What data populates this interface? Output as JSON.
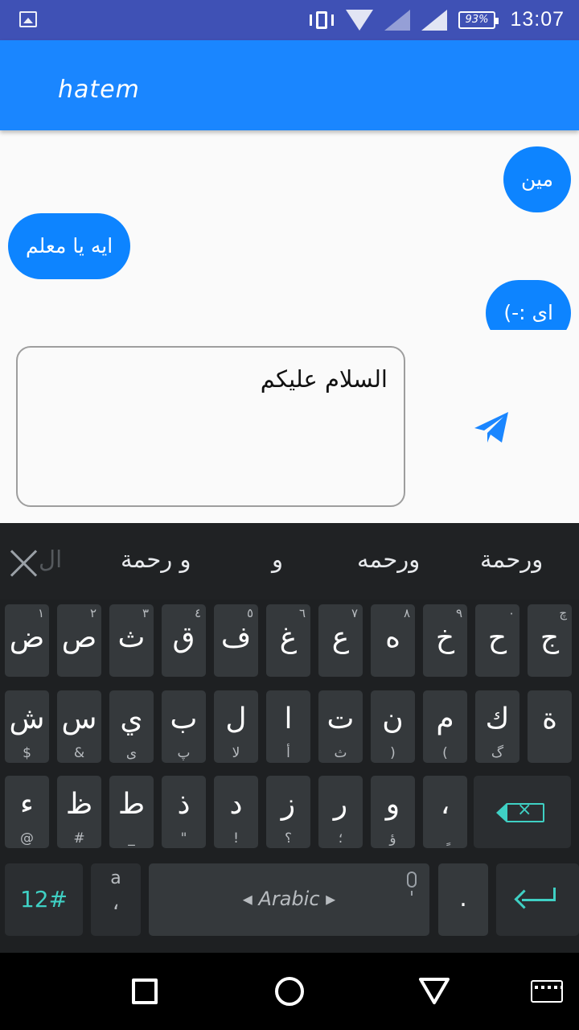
{
  "status_bar": {
    "battery": "93%",
    "time": "13:07"
  },
  "app_bar": {
    "title": "hatem"
  },
  "messages": [
    {
      "text": "مين",
      "side": "right"
    },
    {
      "text": "ايه يا معلم",
      "side": "left"
    },
    {
      "text": "اى :-)",
      "side": "right"
    }
  ],
  "composer": {
    "text": "السلام عليكم"
  },
  "keyboard": {
    "suggestions": [
      "ورحمة",
      "ورحمه",
      "و",
      "و رحمة",
      "ال"
    ],
    "row1": [
      {
        "main": "ض",
        "hint": "١"
      },
      {
        "main": "ص",
        "hint": "٢"
      },
      {
        "main": "ث",
        "hint": "٣"
      },
      {
        "main": "ق",
        "hint": "٤"
      },
      {
        "main": "ف",
        "hint": "٥"
      },
      {
        "main": "غ",
        "hint": "٦"
      },
      {
        "main": "ع",
        "hint": "٧"
      },
      {
        "main": "ه",
        "hint": "٨"
      },
      {
        "main": "خ",
        "hint": "٩"
      },
      {
        "main": "ح",
        "hint": "٠"
      },
      {
        "main": "ج",
        "hint": "چ"
      }
    ],
    "row2": [
      {
        "main": "ش",
        "sub": "$"
      },
      {
        "main": "س",
        "sub": "&"
      },
      {
        "main": "ي",
        "sub": "ى"
      },
      {
        "main": "ب",
        "sub": "پ"
      },
      {
        "main": "ل",
        "sub": "لا"
      },
      {
        "main": "ا",
        "sub": "أ"
      },
      {
        "main": "ت",
        "sub": "ث"
      },
      {
        "main": "ن",
        "sub": ")"
      },
      {
        "main": "م",
        "sub": "("
      },
      {
        "main": "ك",
        "sub": "گ"
      },
      {
        "main": "ة",
        "sub": ""
      }
    ],
    "row3": [
      {
        "main": "ء",
        "sub": "@"
      },
      {
        "main": "ظ",
        "sub": "#"
      },
      {
        "main": "ط",
        "sub": "_"
      },
      {
        "main": "ذ",
        "sub": "\""
      },
      {
        "main": "د",
        "sub": "!"
      },
      {
        "main": "ز",
        "sub": "؟"
      },
      {
        "main": "ر",
        "sub": "؛"
      },
      {
        "main": "و",
        "sub": "ؤ"
      },
      {
        "main": "،",
        "sub": "ٍ"
      }
    ],
    "symbols_key": "12#",
    "emoji_key_top": "a",
    "emoji_key_bottom": "،",
    "space_label": "Arabic",
    "period_key": "."
  }
}
